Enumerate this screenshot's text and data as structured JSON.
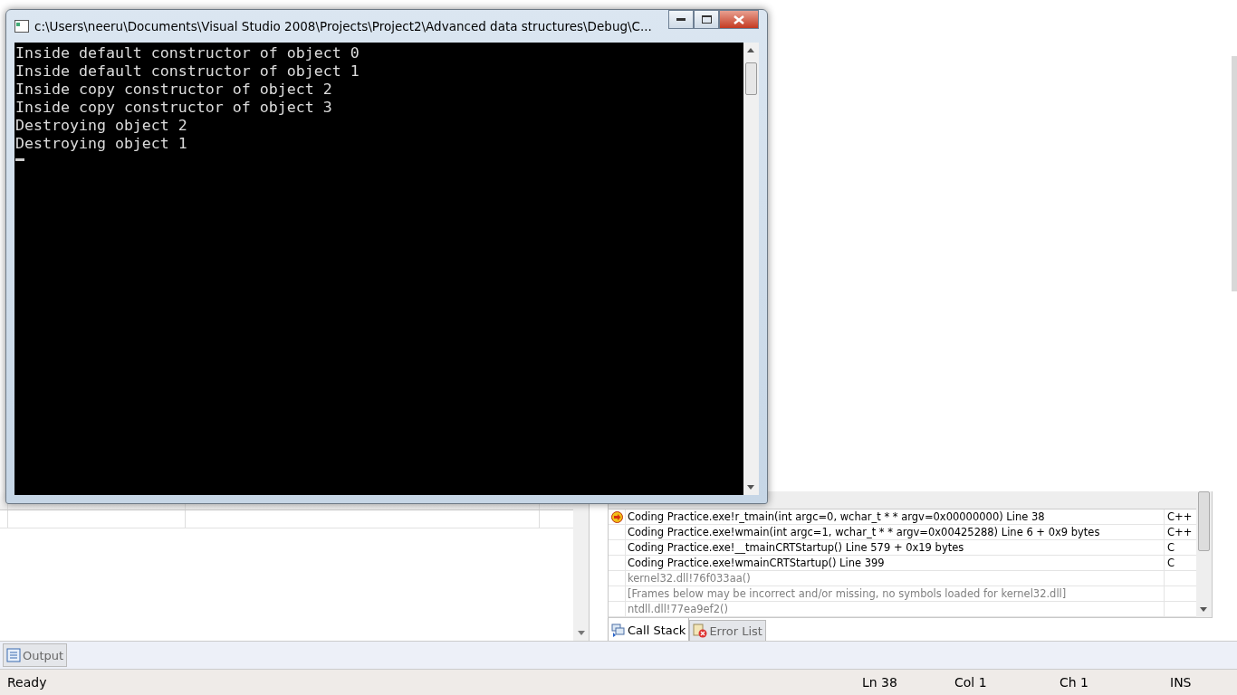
{
  "console": {
    "title": "c:\\Users\\neeru\\Documents\\Visual Studio 2008\\Projects\\Project2\\Advanced data structures\\Debug\\C...",
    "lines": [
      "Inside default constructor of object 0",
      "Inside default constructor of object 1",
      "Inside copy constructor of object 2",
      "Inside copy constructor of object 3",
      "Destroying object 2",
      "Destroying object 1"
    ],
    "cursor": true
  },
  "call_stack": {
    "rows": [
      {
        "name": "Coding Practice.exe!r_tmain(int argc=0, wchar_t * * argv=0x00000000)  Line 38",
        "language": "C++",
        "current": true,
        "greyed": false
      },
      {
        "name": "Coding Practice.exe!wmain(int argc=1, wchar_t * * argv=0x00425288)  Line 6 + 0x9 bytes",
        "language": "C++",
        "current": false,
        "greyed": false
      },
      {
        "name": "Coding Practice.exe!__tmainCRTStartup()  Line 579 + 0x19 bytes",
        "language": "C",
        "current": false,
        "greyed": false
      },
      {
        "name": "Coding Practice.exe!wmainCRTStartup()  Line 399",
        "language": "C",
        "current": false,
        "greyed": false
      },
      {
        "name": "kernel32.dll!76f033aa()",
        "current": false,
        "greyed": true
      },
      {
        "name": "[Frames below may be incorrect and/or missing, no symbols loaded for kernel32.dll]",
        "current": false,
        "greyed": true
      },
      {
        "name": "ntdll.dll!77ea9ef2()",
        "current": false,
        "greyed": true
      }
    ],
    "tabs": [
      {
        "label": "Call Stack",
        "kind": "stack",
        "selected": true
      },
      {
        "label": "Error List",
        "kind": "errors",
        "selected": false
      }
    ]
  },
  "bottom_tabs": [
    {
      "label": "Output",
      "kind": "output",
      "selected": false
    }
  ],
  "status_bar": {
    "message": "Ready",
    "line": "Ln 38",
    "column": "Col 1",
    "char": "Ch 1",
    "mode": "INS"
  }
}
